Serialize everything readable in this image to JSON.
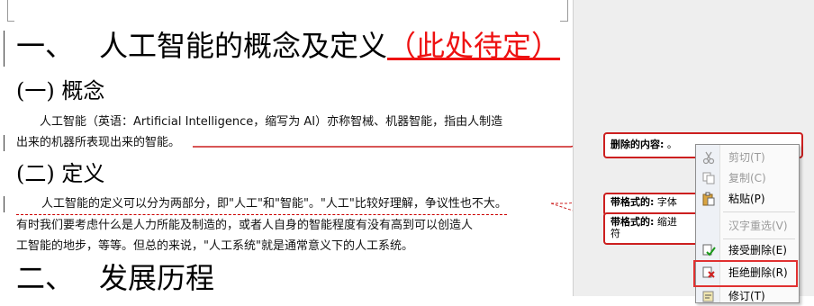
{
  "document": {
    "heading1": {
      "number": "一、",
      "text": "人工智能的概念及定义",
      "inserted": "（此处待定）"
    },
    "section1": {
      "title": "(一) 概念",
      "lines": [
        "人工智能（英语：Artificial Intelligence，缩写为 AI）亦称智械、机器智能，指由人制造",
        "出来的机器所表现出来的智能。"
      ]
    },
    "section2": {
      "title": "(二) 定义",
      "lines": [
        "人工智能的定义可以分为两部分，即\"人工\"和\"智能\"。\"人工\"比较好理解，争议性也不大。",
        "有时我们要考虑什么是人力所能及制造的，或者人自身的智能程度有没有高到可以创造人",
        "工智能的地步，等等。但总的来说，\"人工系统\"就是通常意义下的人工系统。"
      ]
    },
    "heading2": {
      "number": "二、",
      "text": "发展历程"
    }
  },
  "markup": {
    "balloons": [
      {
        "label": "删除的内容:",
        "content": "。"
      },
      {
        "label": "带格式的:",
        "content": "字体"
      },
      {
        "label": "带格式的:",
        "content": "缩进",
        "cont": "符"
      }
    ]
  },
  "context_menu": {
    "items": [
      {
        "label": "剪切(T)",
        "icon": "scissors-icon",
        "disabled": true
      },
      {
        "label": "复制(C)",
        "icon": "copy-icon",
        "disabled": true
      },
      {
        "label": "粘贴(P)",
        "icon": "paste-icon",
        "disabled": false
      },
      {
        "label": "汉字重选(V)",
        "icon": "",
        "disabled": true
      },
      {
        "label": "接受删除(E)",
        "icon": "accept-icon",
        "disabled": false
      },
      {
        "label": "拒绝删除(R)",
        "icon": "reject-icon",
        "disabled": false
      },
      {
        "label": "修订(T)",
        "icon": "track-changes-icon",
        "disabled": false
      }
    ]
  },
  "colors": {
    "insert": "#ee1111",
    "balloon_border": "#cc1f1f",
    "highlight": "#e03131"
  }
}
